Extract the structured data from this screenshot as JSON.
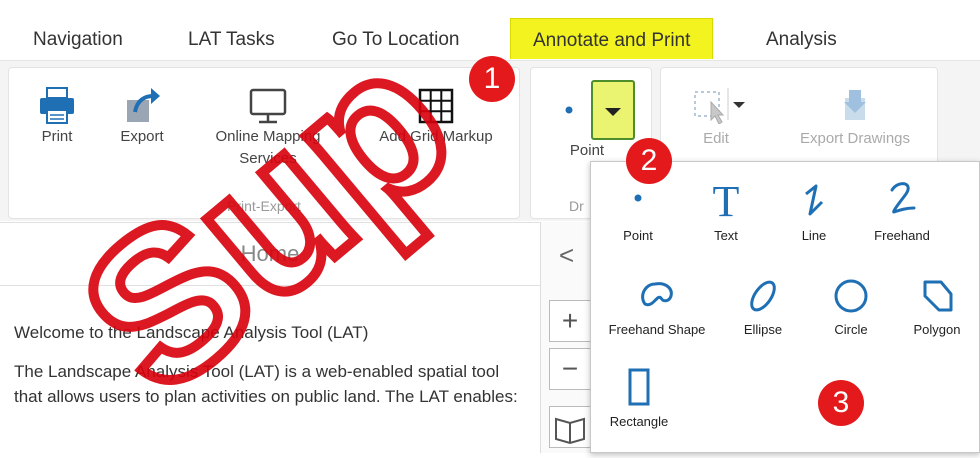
{
  "tabs": [
    {
      "label": "Navigation"
    },
    {
      "label": "LAT Tasks"
    },
    {
      "label": "Go To Location"
    },
    {
      "label": "Annotate and Print"
    },
    {
      "label": "Analysis"
    }
  ],
  "ribbon": {
    "print": "Print",
    "export": "Export",
    "online_mapping": "Online Mapping Services",
    "add_grid": "Add Grid Markup",
    "print_export_group": "Print-Export",
    "point": "Point",
    "draw_group": "Dr",
    "edit": "Edit",
    "export_drawings": "Export Drawings"
  },
  "badges": [
    "1",
    "2",
    "3"
  ],
  "draw_menu": {
    "items": [
      {
        "label": "Point",
        "icon": "point-icon"
      },
      {
        "label": "Text",
        "icon": "text-icon"
      },
      {
        "label": "Line",
        "icon": "line-icon"
      },
      {
        "label": "Freehand",
        "icon": "freehand-icon"
      },
      {
        "label": "Freehand Shape",
        "icon": "freehand-shape-icon"
      },
      {
        "label": "Ellipse",
        "icon": "ellipse-icon"
      },
      {
        "label": "Circle",
        "icon": "circle-icon"
      },
      {
        "label": "Polygon",
        "icon": "polygon-icon"
      },
      {
        "label": "Rectangle",
        "icon": "rectangle-icon"
      }
    ]
  },
  "home": {
    "title": "Home",
    "welcome": "Welcome to the Landscape Analysis Tool (LAT)",
    "description": "The Landscape Analysis Tool (LAT) is a web-enabled spatial tool that allows users to plan activities on public land. The LAT enables:"
  },
  "map_controls": {
    "zoom_in": "+",
    "zoom_out": "−",
    "collapse": "<"
  },
  "watermark": "Sup",
  "colors": {
    "accent_yellow": "#f3f31f",
    "icon_blue": "#1f6fb5",
    "badge_red": "#e3191c",
    "watermark_red": "#d9000c"
  }
}
